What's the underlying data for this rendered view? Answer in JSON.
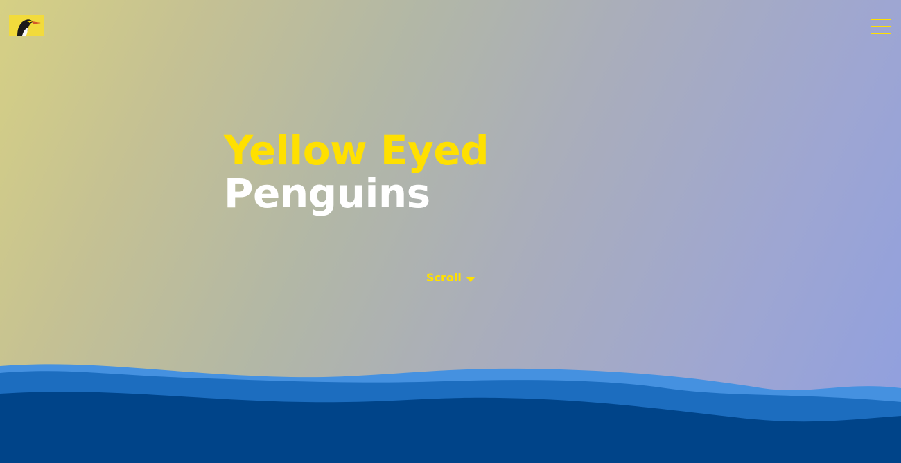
{
  "header": {
    "logo_icon": "penguin-icon",
    "menu_icon": "hamburger-menu-icon"
  },
  "hero": {
    "line1": "Yellow Eyed",
    "line2": "Penguins"
  },
  "scroll": {
    "label": "Scroll",
    "icon": "caret-down-icon"
  },
  "colors": {
    "accent_yellow": "#ffe000",
    "title_white": "#ffffff",
    "logo_bg": "#f2db3c",
    "wave_light": "#4591e0",
    "wave_mid": "#1c6dbf",
    "wave_dark": "#004489"
  }
}
